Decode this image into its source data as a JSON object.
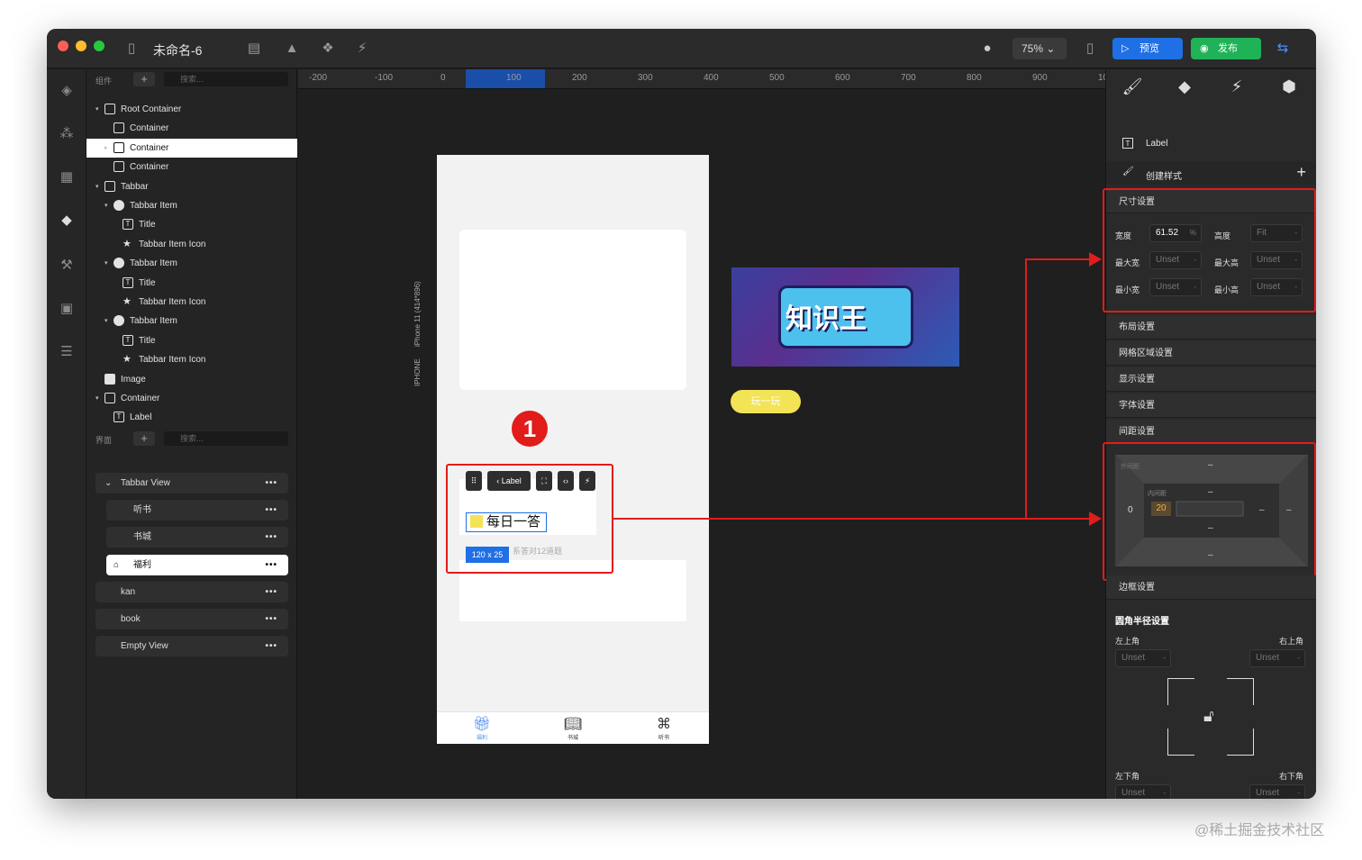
{
  "window": {
    "title": "未命名-6"
  },
  "toolbar": {
    "zoom": "75%",
    "preview_label": "预览",
    "publish_label": "发布"
  },
  "left_panel": {
    "components_label": "组件",
    "search_placeholder": "搜索...",
    "tree": [
      {
        "label": "Root Container",
        "indent": 0,
        "icon": "container-icon",
        "caret": "▾"
      },
      {
        "label": "Container",
        "indent": 1,
        "icon": "container-icon",
        "caret": ""
      },
      {
        "label": "Container",
        "indent": 1,
        "icon": "container-icon",
        "caret": "▸",
        "selected": true
      },
      {
        "label": "Container",
        "indent": 1,
        "icon": "container-icon",
        "caret": ""
      },
      {
        "label": "Tabbar",
        "indent": 0,
        "icon": "tabbar-icon",
        "caret": "▾"
      },
      {
        "label": "Tabbar Item",
        "indent": 1,
        "icon": "tabbar-item-icon",
        "caret": "▾"
      },
      {
        "label": "Title",
        "indent": 2,
        "icon": "text-icon",
        "caret": ""
      },
      {
        "label": "Tabbar Item Icon",
        "indent": 2,
        "icon": "star-icon",
        "caret": ""
      },
      {
        "label": "Tabbar Item",
        "indent": 1,
        "icon": "tabbar-item-icon",
        "caret": "▾"
      },
      {
        "label": "Title",
        "indent": 2,
        "icon": "text-icon",
        "caret": ""
      },
      {
        "label": "Tabbar Item Icon",
        "indent": 2,
        "icon": "star-icon",
        "caret": ""
      },
      {
        "label": "Tabbar Item",
        "indent": 1,
        "icon": "tabbar-item-icon",
        "caret": "▾"
      },
      {
        "label": "Title",
        "indent": 2,
        "icon": "text-icon",
        "caret": ""
      },
      {
        "label": "Tabbar Item Icon",
        "indent": 2,
        "icon": "star-icon",
        "caret": ""
      },
      {
        "label": "Image",
        "indent": 0,
        "icon": "image-icon",
        "caret": ""
      },
      {
        "label": "Container",
        "indent": 0,
        "icon": "container-icon",
        "caret": "▾"
      },
      {
        "label": "Label",
        "indent": 1,
        "icon": "text-icon",
        "caret": ""
      }
    ],
    "views_label": "界面",
    "views": [
      {
        "label": "Tabbar View",
        "indent": 0
      },
      {
        "label": "听书",
        "indent": 1
      },
      {
        "label": "书城",
        "indent": 1
      },
      {
        "label": "福利",
        "indent": 1,
        "selected": true
      },
      {
        "label": "kan",
        "indent": 0
      },
      {
        "label": "book",
        "indent": 0
      },
      {
        "label": "Empty View",
        "indent": 0
      }
    ]
  },
  "ruler": {
    "ticks": [
      "-200",
      "-100",
      "0",
      "100",
      "200",
      "300",
      "400",
      "500",
      "600",
      "700",
      "800",
      "900",
      "10"
    ]
  },
  "canvas": {
    "device_label": "iPhone 11 (414*896)",
    "device_type": "IPHONE",
    "badge": "1",
    "float_toolbar": {
      "label": "Label"
    },
    "selected_label_text": "每日一答",
    "size_chip": "120 x 25",
    "desc_text": "系答对12道题",
    "tabs": [
      {
        "icon": "gift-icon",
        "label": "福利",
        "active": true
      },
      {
        "icon": "book-icon",
        "label": "书城",
        "active": false
      },
      {
        "icon": "command-icon",
        "label": "听书",
        "active": false
      }
    ],
    "banner_text": "知识王",
    "play_button": "玩一玩"
  },
  "inspector": {
    "component_name": "Label",
    "create_style": "创建样式",
    "size": {
      "title": "尺寸设置",
      "width_label": "宽度",
      "width_value": "61.52",
      "width_unit": "%",
      "height_label": "高度",
      "height_value": "Fit",
      "max_w_label": "最大宽",
      "max_w_value": "Unset",
      "max_h_label": "最大高",
      "max_h_value": "Unset",
      "min_w_label": "最小宽",
      "min_w_value": "Unset",
      "min_h_label": "最小高",
      "min_h_value": "Unset",
      "unit_mark": "-"
    },
    "sections": [
      "布局设置",
      "网格区域设置",
      "显示设置",
      "字体设置",
      "间距设置"
    ],
    "spacing": {
      "outer_label": "外间距",
      "inner_label": "内间距",
      "left_outer": "0",
      "left_inner": "20",
      "dash": "–"
    },
    "border_section": "边框设置",
    "radius": {
      "title": "圆角半径设置",
      "top_left": "左上角",
      "top_right": "右上角",
      "bottom_left": "左下角",
      "bottom_right": "右下角",
      "value": "Unset"
    },
    "border_title": "边框"
  },
  "watermark": "@稀土掘金技术社区",
  "colors": {
    "accent": "#1f6fe5",
    "publish": "#20b257",
    "annotation": "#e21b1b"
  }
}
